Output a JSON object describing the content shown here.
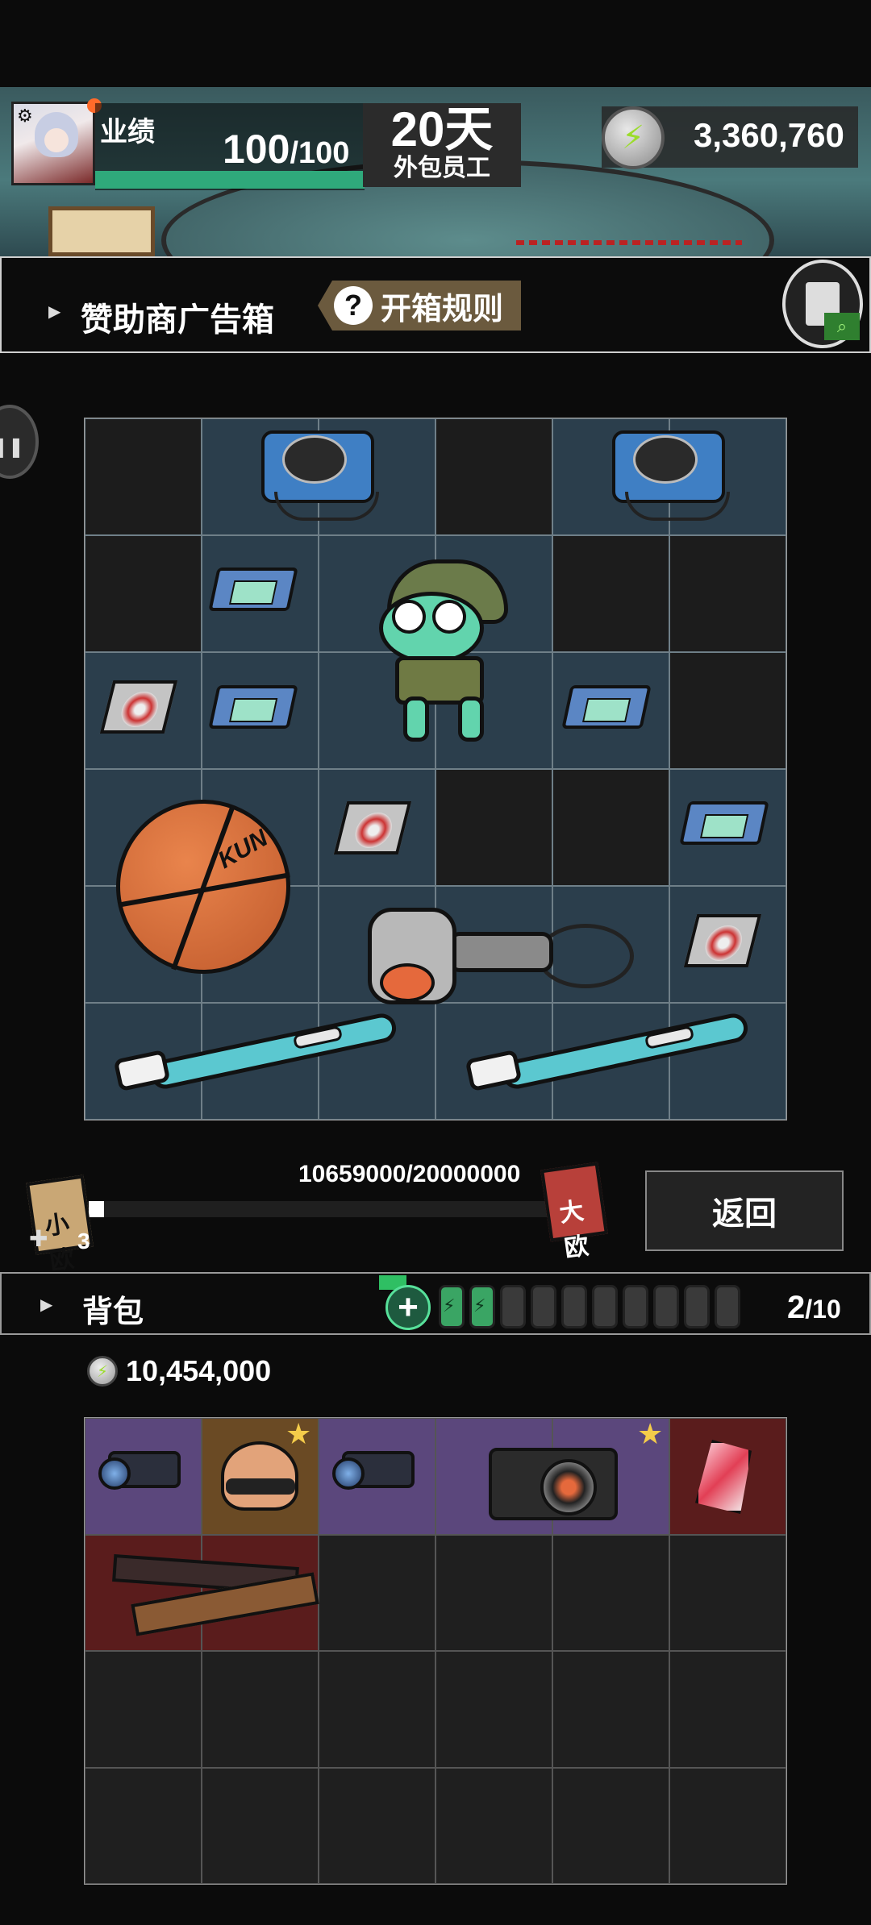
{
  "header": {
    "performance_label": "业绩",
    "performance_current": "100",
    "performance_max": "/100",
    "performance_ratio": 1.0,
    "days_value": "20天",
    "days_role": "外包员工",
    "coins": "3,360,760"
  },
  "box": {
    "title": "赞助商广告箱",
    "rules_label": "开箱规则",
    "rules_icon": "question-icon",
    "clipboard_icon": "clipboard-search-icon",
    "grid_rows": [
      [
        "dark",
        "lit",
        "lit",
        "dark",
        "lit",
        "lit"
      ],
      [
        "dark",
        "lit",
        "lit",
        "lit",
        "dark",
        "dark"
      ],
      [
        "lit",
        "lit",
        "lit",
        "lit",
        "lit",
        "dark"
      ],
      [
        "lit",
        "lit",
        "lit",
        "dark",
        "dark",
        "lit"
      ],
      [
        "lit",
        "lit",
        "lit",
        "lit",
        "lit",
        "lit"
      ],
      [
        "lit",
        "lit",
        "lit",
        "lit",
        "lit",
        "lit"
      ]
    ],
    "items": [
      "disc-player",
      "disc-player",
      "card",
      "card",
      "card",
      "card",
      "cd",
      "cd",
      "cd",
      "frog-doll",
      "basketball",
      "hair-dryer",
      "toothbrush",
      "toothbrush"
    ],
    "basketball_text": "KUN"
  },
  "progress": {
    "text": "10659000/20000000",
    "current": 10659000,
    "max": 20000000,
    "small_ticket_label": "小欧",
    "small_ticket_count": "3",
    "big_ticket_label": "大欧",
    "back_label": "返回"
  },
  "backpack": {
    "title": "背包",
    "add_icon": "plus-icon",
    "batteries_full": 2,
    "batteries_total": 10,
    "count_current": "2",
    "count_max": "/10",
    "money": "10,454,000",
    "grid_rows": [
      [
        "purple",
        "brown",
        "purple",
        "purple",
        "purple",
        "red"
      ],
      [
        "red",
        "red",
        "empty",
        "empty",
        "empty",
        "empty"
      ],
      [
        "empty",
        "empty",
        "empty",
        "empty",
        "empty",
        "empty"
      ],
      [
        "empty",
        "empty",
        "empty",
        "empty",
        "empty",
        "empty"
      ]
    ],
    "items": [
      "scope",
      "helmet",
      "scope",
      "camera",
      "crystal",
      "chopsticks-box"
    ],
    "star_icon": "★"
  },
  "colors": {
    "accent_green": "#2fa97b",
    "cell_lit": "#2b3e4c",
    "cell_dark": "#1c1c1c",
    "rarity_purple": "#5b477c",
    "rarity_gold": "#6a4a24",
    "rarity_red": "#5a1c1c"
  }
}
